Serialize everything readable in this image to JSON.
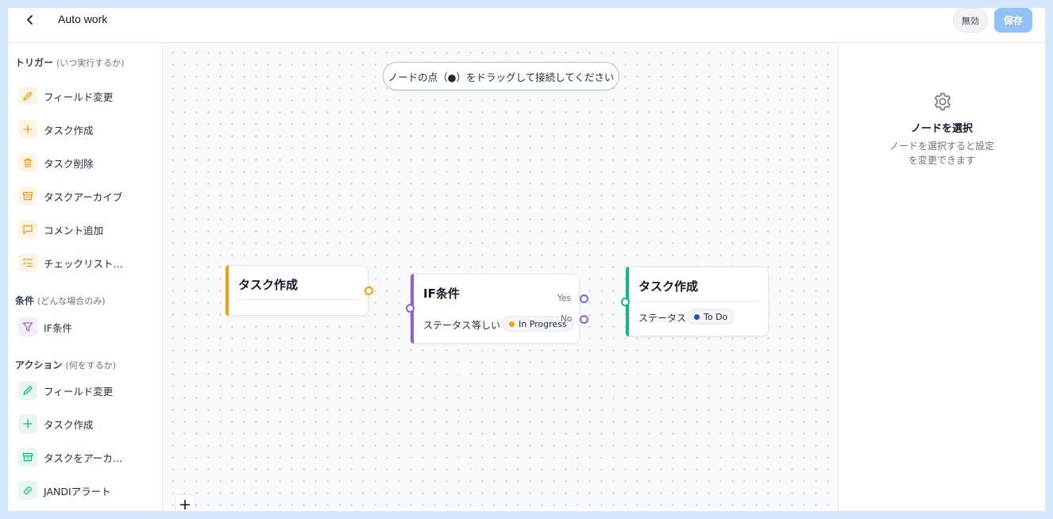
{
  "header": {
    "title": "Auto work",
    "disable_label": "無効",
    "save_label": "保存"
  },
  "sidebar": {
    "trigger_title": "トリガー",
    "trigger_sub": "(いつ実行するか)",
    "triggers": [
      {
        "label": "フィールド変更",
        "icon": "pencil-icon"
      },
      {
        "label": "タスク作成",
        "icon": "plus-icon"
      },
      {
        "label": "タスク削除",
        "icon": "trash-icon"
      },
      {
        "label": "タスクアーカイブ",
        "icon": "archive-icon"
      },
      {
        "label": "コメント追加",
        "icon": "comment-icon"
      },
      {
        "label": "チェックリスト…",
        "icon": "checklist-icon"
      }
    ],
    "condition_title": "条件",
    "condition_sub": "(どんな場合のみ)",
    "conditions": [
      {
        "label": "IF条件",
        "icon": "filter-icon"
      }
    ],
    "action_title": "アクション",
    "action_sub": "(何をするか)",
    "actions": [
      {
        "label": "フィールド変更",
        "icon": "pencil-icon"
      },
      {
        "label": "タスク作成",
        "icon": "plus-icon"
      },
      {
        "label": "タスクをアーカ…",
        "icon": "archive-icon"
      },
      {
        "label": "JANDIアラート",
        "icon": "link-icon"
      }
    ]
  },
  "canvas": {
    "hint": "ノードの点（●）をドラッグして接続してください",
    "trigger_node": {
      "title": "タスク作成"
    },
    "if_node": {
      "title": "IF条件",
      "field": "ステータス",
      "operator": "等しい",
      "value": "In Progress",
      "value_color": "#f59e0b",
      "yes_label": "Yes",
      "no_label": "No"
    },
    "action_node": {
      "title": "タスク作成",
      "field": "ステータス",
      "value": "To Do",
      "value_color": "#1d4ed8"
    },
    "zoom_in_label": "+"
  },
  "right_panel": {
    "title": "ノードを選択",
    "desc_line1": "ノードを選択すると設定",
    "desc_line2": "を変更できます"
  },
  "colors": {
    "trigger": "#f59e0b",
    "condition": "#8b5cf6",
    "action": "#10b981"
  }
}
